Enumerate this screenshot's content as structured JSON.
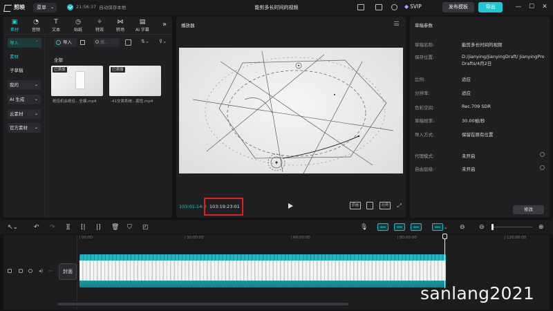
{
  "titlebar": {
    "app_name": "剪映",
    "menu_label": "菜单",
    "save_time": "21:56:37",
    "save_status": "自动保存本地",
    "project_title": "能剪多长时间的视频",
    "vip_label": "SVIP",
    "publish_label": "发布模板",
    "export_label": "导出"
  },
  "media": {
    "tabs": [
      {
        "label": "素材",
        "icon": "media-icon",
        "glyph": "▣"
      },
      {
        "label": "音频",
        "icon": "audio-icon",
        "glyph": "◔"
      },
      {
        "label": "文本",
        "icon": "text-icon",
        "glyph": "T"
      },
      {
        "label": "贴纸",
        "icon": "sticker-icon",
        "glyph": "◷"
      },
      {
        "label": "特效",
        "icon": "effects-icon",
        "glyph": "✧"
      },
      {
        "label": "转场",
        "icon": "transition-icon",
        "glyph": "⋈"
      },
      {
        "label": "AI 字幕",
        "icon": "ai-caption-icon",
        "glyph": "▤"
      }
    ],
    "sidebar": [
      {
        "label": "导入",
        "caret": "⌃"
      },
      {
        "label": "素材"
      },
      {
        "label": "子草稿"
      },
      {
        "label": "我的",
        "caret": "⌄"
      },
      {
        "label": "AI 生成",
        "caret": "⌄"
      },
      {
        "label": "云素材",
        "caret": "⌄"
      },
      {
        "label": "官方素材",
        "caret": "⌄"
      }
    ],
    "import_button": "导入",
    "search_placeholder": "搜...",
    "section_label": "全部",
    "items": [
      {
        "badge": "已添加",
        "name": "绝佳机会绝佳...全编.mp4"
      },
      {
        "badge": "已添加",
        "name": "-41交易系统...套性.mp4"
      }
    ]
  },
  "player": {
    "title": "播放器",
    "current_time": "103:01:14:0",
    "total_time": "103:19:23:01",
    "controls": [
      "原画",
      "比例"
    ]
  },
  "draft": {
    "title": "草稿参数",
    "rows": [
      {
        "label": "草稿名称:",
        "value": "能剪多长时间的视频"
      },
      {
        "label": "保存位置:",
        "value": "D:/jianying/JianyingDraft/ JianyingPro Drafts/4月2日"
      },
      {
        "label": "比例:",
        "value": "适应"
      },
      {
        "label": "分辨率:",
        "value": "适应"
      },
      {
        "label": "色彩空间:",
        "value": "Rec.709 SDR"
      },
      {
        "label": "草稿帧率:",
        "value": "30.00帧/秒"
      },
      {
        "label": "导入方式:",
        "value": "保留在原有位置"
      },
      {
        "label": "代理模式:",
        "value": "未开启"
      },
      {
        "label": "自由层级:",
        "value": "未开启"
      }
    ],
    "modify_button": "修改"
  },
  "timeline": {
    "ruler": [
      "00:00",
      "30:00:00",
      "60:00:00",
      "90:00:00",
      "120:00:00"
    ],
    "cover_label": "封面"
  },
  "watermark": "sanlang2021",
  "colors": {
    "accent": "#21c7c7",
    "highlight_box": "#e0201c",
    "export": "#1fc9d3"
  }
}
